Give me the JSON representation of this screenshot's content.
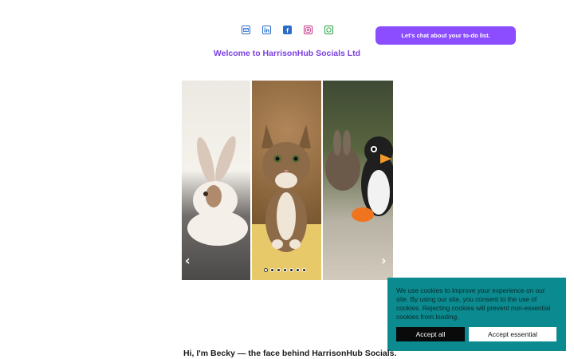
{
  "header": {
    "socials": [
      {
        "name": "email",
        "icon": "email-icon",
        "color": "#2a6cc7"
      },
      {
        "name": "linkedin",
        "icon": "linkedin-icon",
        "color": "#2a6cc7"
      },
      {
        "name": "facebook",
        "icon": "facebook-icon",
        "color": "#2a6cc7"
      },
      {
        "name": "instagram",
        "icon": "instagram-icon",
        "color": "#c13584"
      },
      {
        "name": "whatsapp",
        "icon": "whatsapp-icon",
        "color": "#25a244"
      }
    ],
    "cta_label": "Let's chat about your to-do list.",
    "cta_color": "#8b4dff",
    "welcome": "Welcome to HarrisonHub Socials Ltd",
    "welcome_color": "#7a3fe0"
  },
  "carousel": {
    "slides": [
      "rabbit",
      "kitten",
      "rabbit-with-penguin-toy"
    ],
    "dot_count": 7,
    "active_dot": 1
  },
  "cookie_banner": {
    "text": "We use cookies to improve your experience on our site. By using our site, you consent to the use of cookies. Rejecting cookies will prevent non-essential cookies from loading.",
    "accept_all_label": "Accept all",
    "accept_essential_label": "Accept essential",
    "bg_color": "#0b8a8f"
  },
  "intro": {
    "text": "Hi, I'm Becky — the face behind HarrisonHub Socials."
  }
}
